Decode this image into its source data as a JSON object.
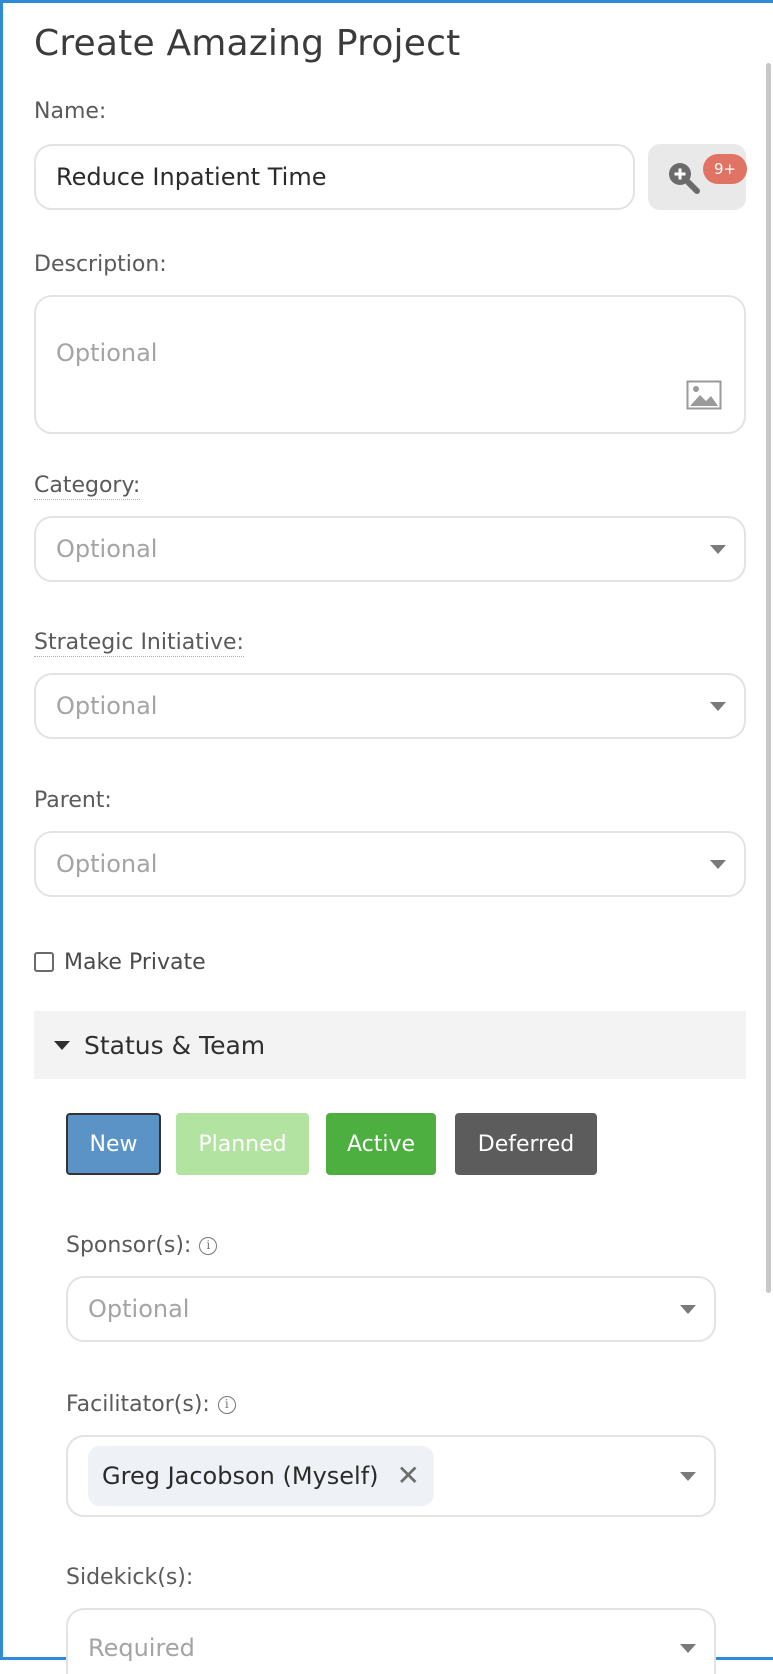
{
  "title": "Create Amazing Project",
  "name": {
    "label": "Name:",
    "value": "Reduce Inpatient Time",
    "search_badge": "9+"
  },
  "description": {
    "label": "Description:",
    "placeholder": "Optional"
  },
  "category": {
    "label": "Category:",
    "placeholder": "Optional"
  },
  "strategic_initiative": {
    "label": "Strategic Initiative:",
    "placeholder": "Optional"
  },
  "parent": {
    "label": "Parent:",
    "placeholder": "Optional"
  },
  "make_private": {
    "label": "Make Private",
    "checked": false
  },
  "status_team": {
    "header": "Status & Team",
    "statuses": [
      {
        "label": "New",
        "selected": true,
        "color": "#5b93c7"
      },
      {
        "label": "Planned",
        "selected": false,
        "color": "#b2e3a0"
      },
      {
        "label": "Active",
        "selected": false,
        "color": "#4caf3f"
      },
      {
        "label": "Deferred",
        "selected": false,
        "color": "#5c5c5c"
      }
    ],
    "sponsors": {
      "label": "Sponsor(s):",
      "placeholder": "Optional"
    },
    "facilitators": {
      "label": "Facilitator(s):",
      "selected_chip": "Greg Jacobson (Myself)"
    },
    "sidekicks": {
      "label": "Sidekick(s):",
      "placeholder": "Required"
    }
  },
  "colors": {
    "frame_border": "#2f8ad8",
    "badge": "#e07363"
  }
}
